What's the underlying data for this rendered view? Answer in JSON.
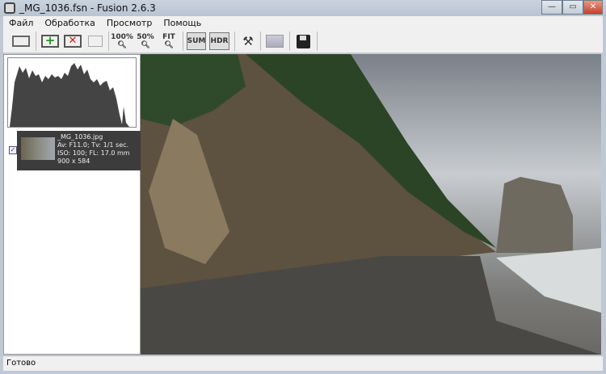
{
  "window": {
    "title": "_MG_1036.fsn - Fusion 2.6.3",
    "minimize": "—",
    "maximize": "▭",
    "close": "✕"
  },
  "menu": [
    "Файл",
    "Обработка",
    "Просмотр",
    "Помощь"
  ],
  "toolbar": {
    "zoom100": "100%",
    "zoom50": "50%",
    "fit": "FIT",
    "sum": "SUM",
    "hdr": "HDR"
  },
  "files": [
    {
      "name": "_MG_1036.jpg",
      "exposure": "Av: F11.0; Tv: 1/1 sec.",
      "iso": "ISO: 100; FL: 17.0 mm",
      "size": "900 x 584",
      "checked": true
    }
  ],
  "status": "Готово"
}
